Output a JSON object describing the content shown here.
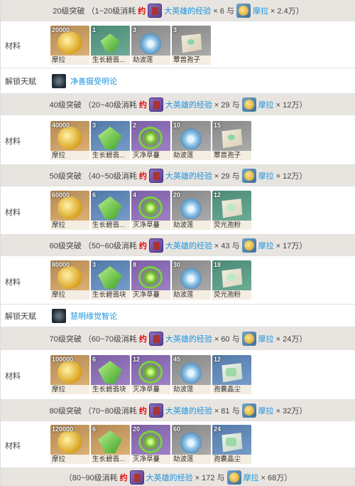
{
  "sections": [
    {
      "header": {
        "level": "20级突破",
        "range": "（1~20级消耗",
        "yue": "约",
        "exp_name": "大英雄的经验",
        "exp_qty": "× 6 与",
        "mora_name": "摩拉",
        "mora_qty": "× 2.4万）"
      },
      "label": "材料",
      "items": [
        {
          "count": "20000",
          "name": "摩拉",
          "icon": "mora-icon"
        },
        {
          "count": "1",
          "name": "生长碧翡...",
          "icon": "gem-icon"
        },
        {
          "count": "3",
          "name": "劫波莲",
          "icon": "lotus-icon"
        },
        {
          "count": "3",
          "name": "蕈兽孢子",
          "icon": "spore-icon"
        }
      ]
    },
    {
      "header": {
        "level": "40级突破",
        "range": "（20~40级消耗",
        "yue": "约",
        "exp_name": "大英雄的经验",
        "exp_qty": "× 29 与",
        "mora_name": "摩拉",
        "mora_qty": "× 12万）"
      },
      "label": "材料",
      "items": [
        {
          "count": "40000",
          "name": "摩拉",
          "icon": "mora-icon"
        },
        {
          "count": "3",
          "name": "生长碧翡...",
          "icon": "gem-icon"
        },
        {
          "count": "2",
          "name": "灭净草蔓",
          "icon": "plant-icon"
        },
        {
          "count": "10",
          "name": "劫波莲",
          "icon": "lotus-icon"
        },
        {
          "count": "15",
          "name": "蕈兽孢子",
          "icon": "spore-icon"
        }
      ]
    },
    {
      "header": {
        "level": "50级突破",
        "range": "（40~50级消耗",
        "yue": "约",
        "exp_name": "大英雄的经验",
        "exp_qty": "× 29 与",
        "mora_name": "摩拉",
        "mora_qty": "× 12万）"
      },
      "label": "材料",
      "items": [
        {
          "count": "60000",
          "name": "摩拉",
          "icon": "mora-icon"
        },
        {
          "count": "6",
          "name": "生长碧翡...",
          "icon": "gem-icon"
        },
        {
          "count": "4",
          "name": "灭净草蔓",
          "icon": "plant-icon"
        },
        {
          "count": "20",
          "name": "劫波莲",
          "icon": "lotus-icon"
        },
        {
          "count": "12",
          "name": "荧光孢粉",
          "icon": "powder-icon"
        }
      ]
    },
    {
      "header": {
        "level": "60级突破",
        "range": "（50~60级消耗",
        "yue": "约",
        "exp_name": "大英雄的经验",
        "exp_qty": "× 43 与",
        "mora_name": "摩拉",
        "mora_qty": "× 17万）"
      },
      "label": "材料",
      "items": [
        {
          "count": "80000",
          "name": "摩拉",
          "icon": "mora-icon"
        },
        {
          "count": "3",
          "name": "生长碧翡块",
          "icon": "gem-icon"
        },
        {
          "count": "8",
          "name": "灭净草蔓",
          "icon": "plant-icon"
        },
        {
          "count": "30",
          "name": "劫波莲",
          "icon": "lotus-icon"
        },
        {
          "count": "18",
          "name": "荧光孢粉",
          "icon": "powder-icon"
        }
      ]
    },
    {
      "header": {
        "level": "70级突破",
        "range": "（60~70级消耗",
        "yue": "约",
        "exp_name": "大英雄的经验",
        "exp_qty": "× 60 与",
        "mora_name": "摩拉",
        "mora_qty": "× 24万）"
      },
      "label": "材料",
      "items": [
        {
          "count": "100000",
          "name": "摩拉",
          "icon": "mora-icon"
        },
        {
          "count": "6",
          "name": "生长碧翡块",
          "icon": "gem-icon"
        },
        {
          "count": "12",
          "name": "灭净草蔓",
          "icon": "plant-icon"
        },
        {
          "count": "45",
          "name": "劫波莲",
          "icon": "lotus-icon"
        },
        {
          "count": "12",
          "name": "孢囊晶尘",
          "icon": "crystal-icon"
        }
      ]
    },
    {
      "header": {
        "level": "80级突破",
        "range": "（70~80级消耗",
        "yue": "约",
        "exp_name": "大英雄的经验",
        "exp_qty": "× 81 与",
        "mora_name": "摩拉",
        "mora_qty": "× 32万）"
      },
      "label": "材料",
      "items": [
        {
          "count": "120000",
          "name": "摩拉",
          "icon": "mora-icon"
        },
        {
          "count": "6",
          "name": "生长碧翡...",
          "icon": "gem-icon"
        },
        {
          "count": "20",
          "name": "灭净草蔓",
          "icon": "plant-icon"
        },
        {
          "count": "60",
          "name": "劫波莲",
          "icon": "lotus-icon"
        },
        {
          "count": "24",
          "name": "孢囊晶尘",
          "icon": "crystal-icon"
        }
      ]
    }
  ],
  "talents": [
    {
      "label": "解锁天赋",
      "name": "净善摄受明论",
      "icon": "talent-icon"
    },
    {
      "label": "解锁天赋",
      "name": "慧明缘觉智论",
      "icon": "talent-icon"
    }
  ],
  "footer": {
    "range": "（80~90级消耗",
    "yue": "约",
    "exp_name": "大英雄的经验",
    "exp_qty": "× 172 与",
    "mora_name": "摩拉",
    "mora_qty": "× 68万）"
  }
}
